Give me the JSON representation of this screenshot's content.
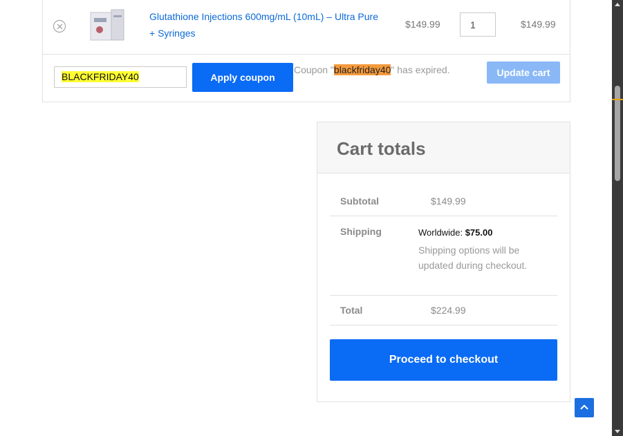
{
  "cart": {
    "product": {
      "name": "Glutathione Injections 600mg/mL (10mL) – Ultra Pure + Syringes",
      "price": "$149.99",
      "quantity": "1",
      "subtotal": "$149.99"
    },
    "coupon": {
      "input_value": "BLACKFRIDAY40",
      "apply_label": "Apply coupon",
      "message_prefix": "Coupon \"",
      "message_code": "blackfriday40",
      "message_suffix": "\" has expired."
    },
    "update_label": "Update cart"
  },
  "totals": {
    "title": "Cart totals",
    "subtotal_label": "Subtotal",
    "subtotal_value": "$149.99",
    "shipping_label": "Shipping",
    "shipping_method": "Worldwide:",
    "shipping_cost": "$75.00",
    "shipping_note": "Shipping options will be updated during checkout.",
    "total_label": "Total",
    "total_value": "$224.99",
    "checkout_label": "Proceed to checkout"
  },
  "colors": {
    "primary": "#0a6bf5",
    "link": "#0a6ad8",
    "coupon_highlight": "#ffff33",
    "message_highlight": "#f59a3c"
  },
  "icons": {
    "remove": "remove-icon",
    "back_to_top": "chevron-up-icon"
  }
}
